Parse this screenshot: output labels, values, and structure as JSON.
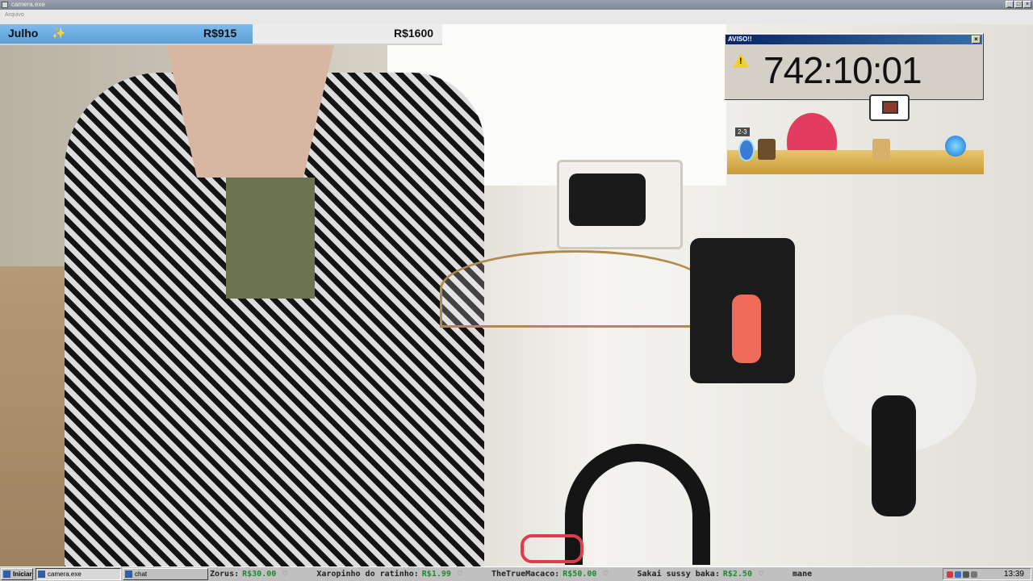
{
  "window": {
    "title": "camera.exe",
    "menu": "Arquivo"
  },
  "donation_goal": {
    "month": "Julho",
    "sparkle": "✨",
    "current": "R$915",
    "goal": "R$1600",
    "progress_fraction": 0.572
  },
  "alert": {
    "title": "AVISO!!",
    "close": "×",
    "warning_icon": "!",
    "timer": "742:10:01"
  },
  "game_overlay": {
    "level": "2-3"
  },
  "taskbar": {
    "start_label": "Iniciar",
    "tasks": [
      "camera.exe",
      "chat"
    ],
    "ticker": [
      {
        "name": "Zorus:",
        "amount": "R$30.00"
      },
      {
        "name": "Xaropinho do ratinho:",
        "amount": "R$1.99"
      },
      {
        "name": "TheTrueMacaco:",
        "amount": "R$50.00"
      },
      {
        "name": "Sakai sussy baka:",
        "amount": "R$2.50"
      },
      {
        "name": "mane",
        "amount": ""
      }
    ],
    "heart": "♡",
    "clock": "13:39"
  },
  "colors": {
    "progress_fill": "#5a9fd6",
    "alert_title_bar": "#0a246a",
    "ticker_amount": "#1c8a2e",
    "warning_yellow": "#f3cf2a"
  }
}
